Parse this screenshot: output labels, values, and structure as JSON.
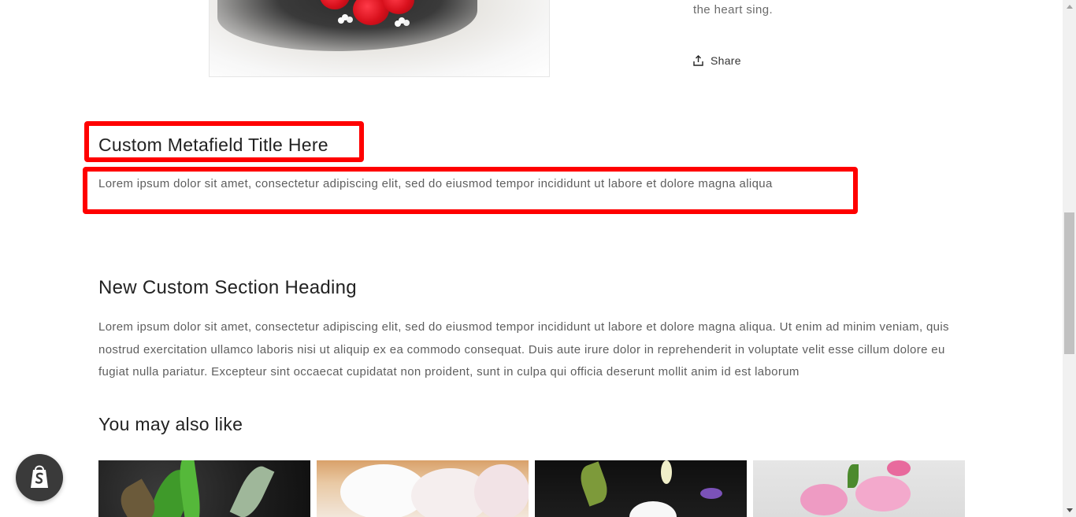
{
  "product": {
    "description_tail": "the heart sing.",
    "share_label": "Share"
  },
  "metafield": {
    "title": "Custom Metafield Title Here",
    "text": "Lorem ipsum dolor sit amet, consectetur adipiscing elit, sed do eiusmod tempor incididunt ut labore et dolore magna aliqua"
  },
  "custom_section": {
    "heading": "New Custom Section Heading",
    "body": "Lorem ipsum dolor sit amet, consectetur adipiscing elit, sed do eiusmod tempor incididunt ut labore et dolore magna aliqua. Ut enim ad minim veniam, quis nostrud exercitation ullamco laboris nisi ut aliquip ex ea commodo consequat. Duis aute irure dolor in reprehenderit in voluptate velit esse cillum dolore eu fugiat nulla pariatur. Excepteur sint occaecat cupidatat non proident, sunt in culpa qui officia deserunt mollit anim id est laborum"
  },
  "recommendations": {
    "heading": "You may also like"
  },
  "icons": {
    "share": "share-icon",
    "shopify": "shopify-bag-icon"
  },
  "colors": {
    "highlight": "#ff0000",
    "text_muted": "#5e5e5e",
    "shopify_badge": "#3a3a3a"
  }
}
